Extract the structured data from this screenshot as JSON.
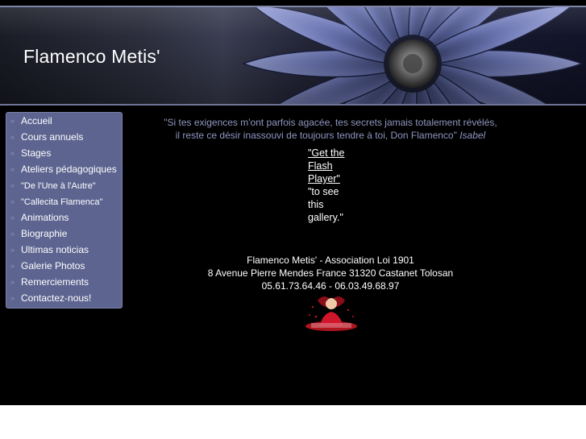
{
  "site": {
    "title": "Flamenco Metis'"
  },
  "nav": {
    "items": [
      "Accueil",
      "Cours annuels",
      "Stages",
      "Ateliers pédagogiques",
      "\"De l'Une à l'Autre\"",
      "\"Callecita Flamenca\"",
      "Animations",
      "Biographie",
      "Ultimas noticias",
      "Galerie Photos",
      "Remerciements",
      "Contactez-nous!"
    ]
  },
  "quote": {
    "line1": "\"Si tes exigences m'ont parfois agacée, tes secrets jamais totalement révélés,",
    "line2": "il reste ce désir inassouvi de toujours tendre à toi, Don Flamenco\"",
    "author": "Isabel"
  },
  "flash": {
    "link_lines": [
      "\"Get the",
      "Flash",
      "Player\""
    ],
    "text_lines": [
      "\"to see",
      "this",
      "gallery.\""
    ]
  },
  "footer": {
    "line1": "Flamenco Metis' - Association Loi 1901",
    "line2": "8 Avenue Pierre Mendes France 31320 Castanet Tolosan",
    "line3": "05.61.73.64.46 - 06.03.49.68.97"
  },
  "colors": {
    "background": "#000000",
    "sidebar": "#5d6490",
    "quote_text": "#8f96c0",
    "banner_border": "#7f86a8"
  },
  "icons": {
    "nav_bullet": "double-chevron-right-icon"
  }
}
